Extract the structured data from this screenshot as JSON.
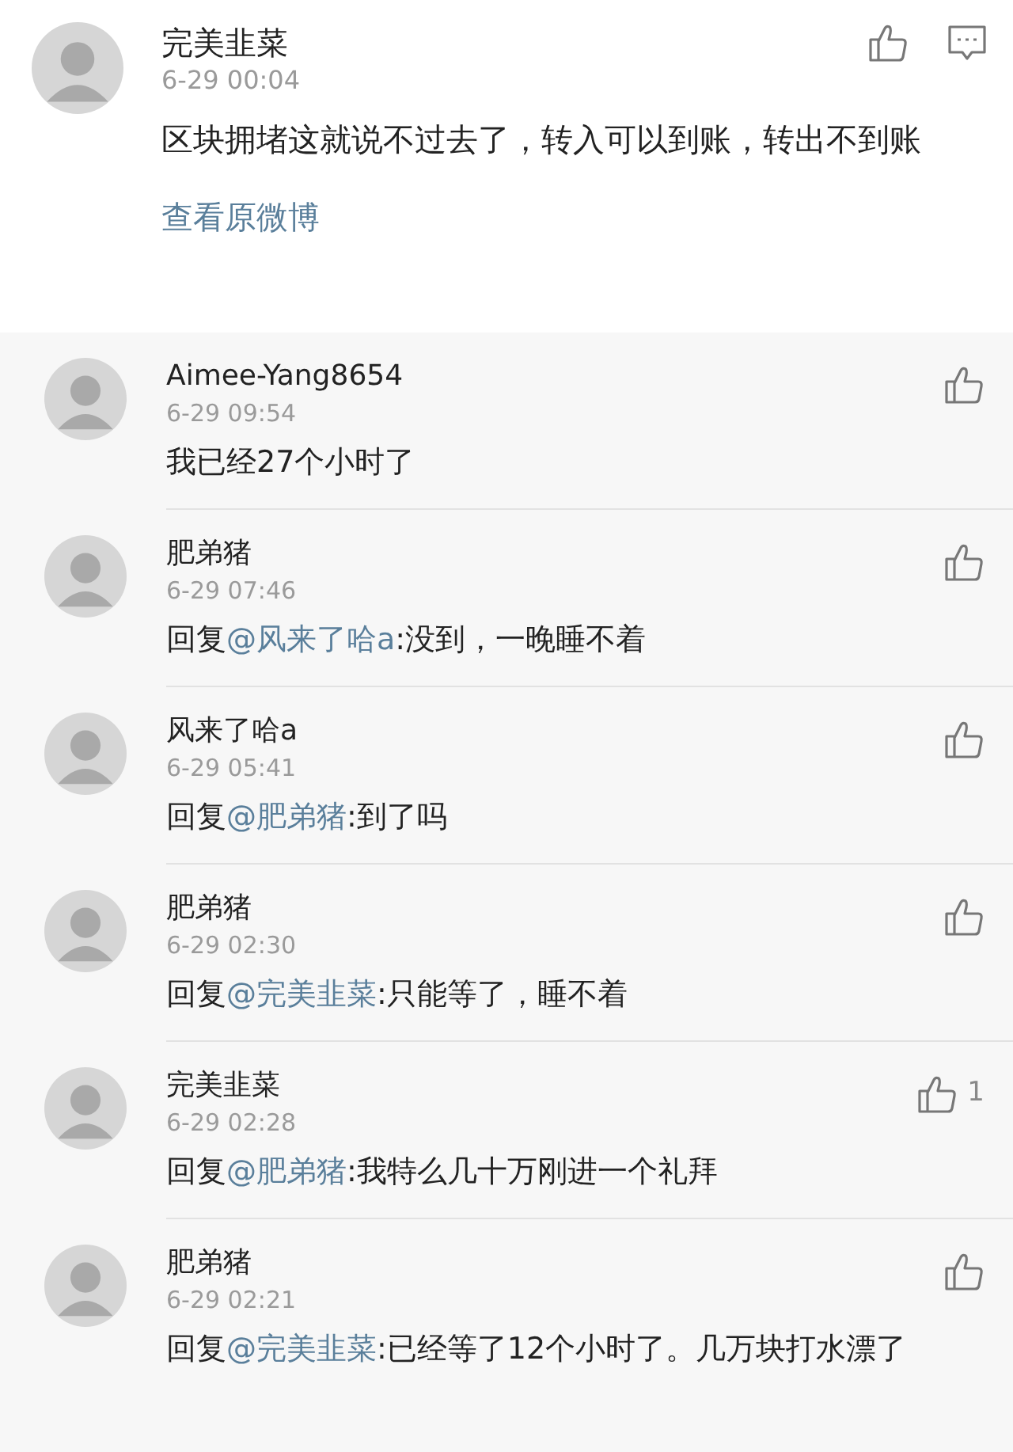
{
  "post": {
    "author": "完美韭菜",
    "time": "6-29 00:04",
    "text": "区块拥堵这就说不过去了，转入可以到账，转出不到账",
    "link": "查看原微博"
  },
  "replies": [
    {
      "author": "Aimee-Yang8654",
      "time": "6-29 09:54",
      "text": "我已经27个小时了"
    },
    {
      "author": "肥弟猪",
      "time": "6-29 07:46",
      "prefix": "回复",
      "mention": "@风来了哈a",
      "text": ":没到，一晚睡不着"
    },
    {
      "author": "风来了哈a",
      "time": "6-29 05:41",
      "prefix": "回复",
      "mention": "@肥弟猪",
      "text": ":到了吗"
    },
    {
      "author": "肥弟猪",
      "time": "6-29 02:30",
      "prefix": "回复",
      "mention": "@完美韭菜",
      "text": ":只能等了，睡不着"
    },
    {
      "author": "完美韭菜",
      "time": "6-29 02:28",
      "prefix": "回复",
      "mention": "@肥弟猪",
      "text": ":我特么几十万刚进一个礼拜",
      "like_count": "1"
    },
    {
      "author": "肥弟猪",
      "time": "6-29 02:21",
      "prefix": "回复",
      "mention": "@完美韭菜",
      "text": ":已经等了12个小时了。几万块打水漂了"
    }
  ]
}
